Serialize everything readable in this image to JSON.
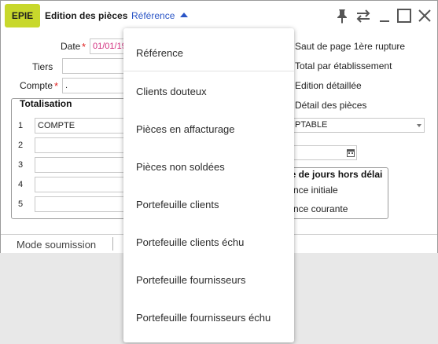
{
  "app_badge": "EPIE",
  "window_title": "Edition des pièces",
  "dropdown_trigger": "Référence",
  "form": {
    "date_label": "Date",
    "date_value": "01/01/19",
    "tiers_label": "Tiers",
    "compte_label": "Compte",
    "compte_value": ".",
    "totalisation_title": "Totalisation",
    "rows": [
      {
        "num": "1",
        "value": "COMPTE"
      },
      {
        "num": "2",
        "value": ""
      },
      {
        "num": "3",
        "value": ""
      },
      {
        "num": "4",
        "value": ""
      },
      {
        "num": "5",
        "value": ""
      }
    ]
  },
  "right": {
    "checkboxes": [
      "Saut de page 1ère rupture",
      "Total par établissement",
      "Edition détaillée",
      "Détail des pièces"
    ],
    "select_value": "PTABLE",
    "group_title": "re de jours hors délai",
    "group_options": [
      "nce initiale",
      "nce courante"
    ]
  },
  "bottom_tab": "Mode soumission",
  "menu": {
    "items": [
      "Référence",
      "Clients douteux",
      "Pièces en affacturage",
      "Pièces non soldées",
      "Portefeuille clients",
      "Portefeuille clients échu",
      "Portefeuille fournisseurs",
      "Portefeuille fournisseurs échu"
    ]
  },
  "colors": {
    "badge": "#c8d82c",
    "accent_link": "#2a55c6",
    "required": "#e02020",
    "date_text": "#d1297b"
  },
  "icons": {
    "pin": "pin-icon",
    "swap": "swap-arrows-icon",
    "minimize": "minimize-icon",
    "maximize": "maximize-icon",
    "close": "close-icon",
    "calendar": "calendar-icon",
    "dropdown_up": "chevron-up-icon"
  }
}
